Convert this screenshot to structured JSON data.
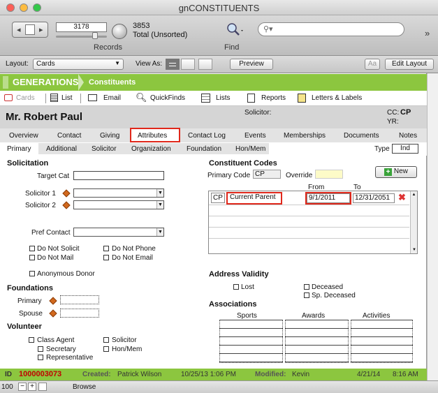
{
  "window": {
    "title": "gnCONSTITUENTS"
  },
  "toolbar": {
    "record_current": "3178",
    "records_label": "Records",
    "total_count": "3853",
    "total_label": "Total (Unsorted)",
    "find_label": "Find",
    "search_placeholder": ""
  },
  "layoutbar": {
    "layout_label": "Layout:",
    "layout_value": "Cards",
    "view_as_label": "View As:",
    "preview_label": "Preview",
    "aa_label": "Aa",
    "edit_layout_label": "Edit Layout"
  },
  "header": {
    "brand": "GENERATIONS",
    "section": "Constituents"
  },
  "iconbar": [
    "Cards",
    "List",
    "Email",
    "QuickFinds",
    "Lists",
    "Reports",
    "Letters & Labels"
  ],
  "record": {
    "name": "Mr. Robert Paul",
    "solicitor_label": "Solicitor:",
    "cc_label": "CC:",
    "cc_value": "CP",
    "yr_label": "YR:"
  },
  "tabs": [
    "Overview",
    "Contact",
    "Giving",
    "Attributes",
    "Contact Log",
    "Events",
    "Memberships",
    "Documents",
    "Notes"
  ],
  "subtabs": [
    "Primary",
    "Additional",
    "Solicitor",
    "Organization",
    "Foundation",
    "Hon/Mem"
  ],
  "type": {
    "label": "Type",
    "value": "Ind"
  },
  "solicitation": {
    "title": "Solicitation",
    "target_cat": "Target Cat",
    "solicitor1": "Solicitor 1",
    "solicitor2": "Solicitor 2",
    "pref_contact": "Pref Contact",
    "do_not_solicit": "Do Not Solicit",
    "do_not_phone": "Do Not Phone",
    "do_not_mail": "Do Not Mail",
    "do_not_email": "Do Not Email",
    "anonymous_donor": "Anonymous Donor"
  },
  "foundations": {
    "title": "Foundations",
    "primary": "Primary",
    "spouse": "Spouse"
  },
  "volunteer": {
    "title": "Volunteer",
    "class_agent": "Class Agent",
    "solicitor": "Solicitor",
    "secretary": "Secretary",
    "hon_mem": "Hon/Mem",
    "representative": "Representative"
  },
  "constituent_codes": {
    "title": "Constituent Codes",
    "primary_code_label": "Primary Code",
    "primary_code_value": "CP",
    "override_label": "Override",
    "new_label": "New",
    "from_label": "From",
    "to_label": "To",
    "rows": [
      {
        "code": "CP",
        "desc": "Current Parent",
        "from": "9/1/2011",
        "to": "12/31/2051"
      }
    ]
  },
  "address_validity": {
    "title": "Address Validity",
    "lost": "Lost",
    "deceased": "Deceased",
    "sp_deceased": "Sp. Deceased"
  },
  "associations": {
    "title": "Associations",
    "sports": "Sports",
    "awards": "Awards",
    "activities": "Activities"
  },
  "footer": {
    "id_label": "ID",
    "id_value": "1000003073",
    "created_label": "Created:",
    "created_by": "Patrick Wilson",
    "created_date": "10/25/13 1:06 PM",
    "modified_label": "Modified:",
    "modified_by": "Kevin",
    "modified_date": "4/21/14",
    "modified_time": "8:16 AM"
  },
  "status": {
    "zoom": "100",
    "mode": "Browse"
  },
  "colors": {
    "brand_green": "#8cc63f",
    "id_red": "#c00000",
    "highlight_red": "#e0281b"
  }
}
